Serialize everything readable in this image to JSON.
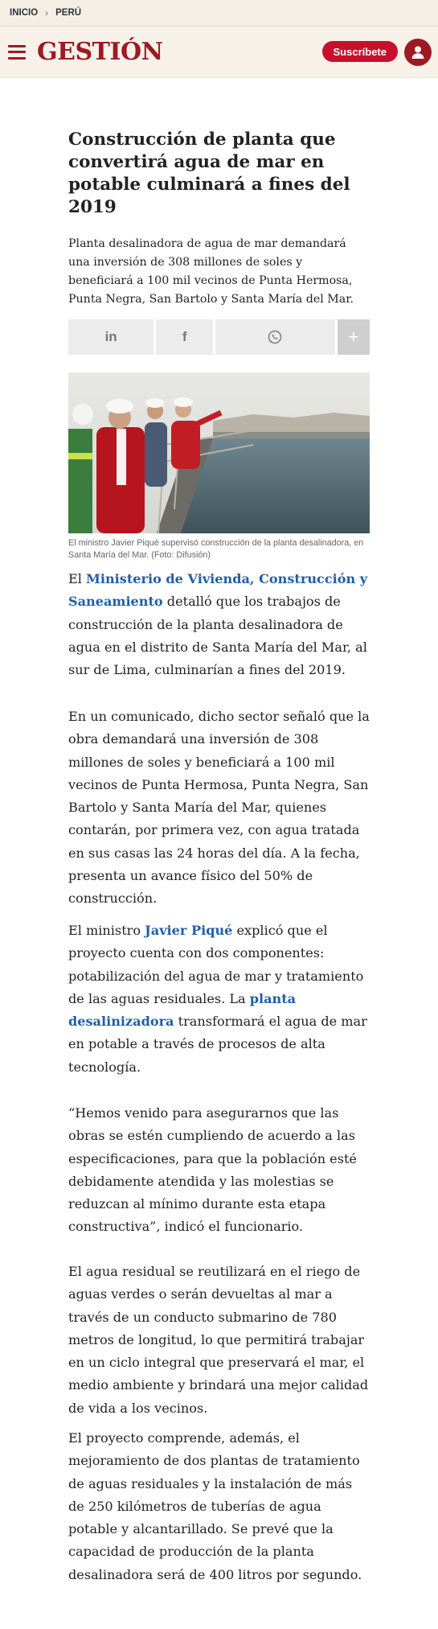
{
  "breadcrumb": {
    "home": "INICIO",
    "section": "PERÚ"
  },
  "header": {
    "logo": "GESTIÓN",
    "subscribe": "Suscríbete"
  },
  "article": {
    "title": "Construcción de planta que convertirá agua de mar en potable culminará a fines del 2019",
    "subtitle": "Planta desalinadora de agua de mar demandará una inversión de 308 millones de soles y beneficiará a 100 mil vecinos de Punta Hermosa, Punta Negra, San Bartolo y Santa María del Mar.",
    "share": {
      "linkedin": "in",
      "facebook": "f",
      "whatsapp": "whatsapp",
      "more": "+"
    },
    "caption": "El ministro Javier Piqué supervisó construcción de la planta desalinadora, en Santa María del Mar. (Foto: Difusión)",
    "p1": {
      "pre": "El ",
      "link": "Ministerio de Vivienda, Construcción y Saneamiento",
      "post": " detalló que los trabajos de construcción de la planta desalinadora de agua en el distrito de Santa María del Mar, al sur de Lima, culminarían a fines del 2019."
    },
    "p2": "En un comunicado, dicho sector señaló que la obra demandará una inversión de 308 millones de soles y beneficiará a 100 mil vecinos de Punta Hermosa, Punta Negra, San Bartolo y Santa María del Mar, quienes contarán, por primera vez, con agua tratada en sus casas las 24 horas del día. A la fecha, presenta un avance físico del 50% de construcción.",
    "p3": {
      "pre": "El ministro ",
      "link1": "Javier Piqué",
      "mid": " explicó que el proyecto cuenta con dos componentes: potabilización del agua de mar y tratamiento de las aguas residuales. La ",
      "link2": "planta desalinizadora",
      "post": " transformará el agua de mar en potable a través de procesos de alta tecnología."
    },
    "p4": "“Hemos venido para asegurarnos que las obras se estén cumpliendo de acuerdo a las especificaciones, para que la población esté debidamente atendida y las molestias se reduzcan al mínimo durante esta etapa constructiva”, indicó el funcionario.",
    "p5": "El agua residual se reutilizará en el riego de aguas verdes o serán devueltas al mar a través de un conducto submarino de 780 metros de longitud, lo que permitirá trabajar en un ciclo integral que preservará el mar, el medio ambiente y brindará una mejor calidad de vida a los vecinos.",
    "p6": "El proyecto comprende, además, el mejoramiento de dos plantas de tratamiento de aguas residuales y la instalación de más de 250 kilómetros de tuberías de agua potable y alcantarillado. Se prevé que la capacidad de producción de la planta desalinadora será de 400 litros por segundo."
  },
  "colors": {
    "brand": "#9e1a22",
    "subscribe": "#c8102e",
    "link": "#1f5fa8",
    "header_bg": "#f7f1e9"
  }
}
